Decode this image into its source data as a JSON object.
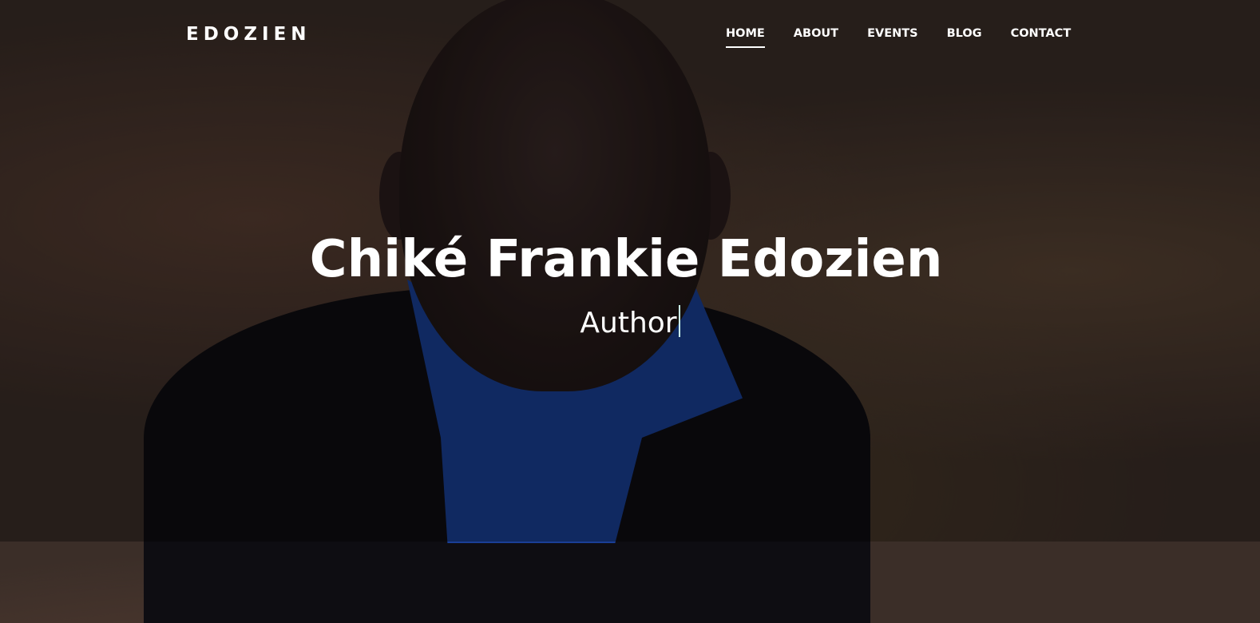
{
  "nav": {
    "logo": "EDOZIEN",
    "items": [
      {
        "label": "HOME",
        "active": true
      },
      {
        "label": "ABOUT"
      },
      {
        "label": "EVENTS"
      },
      {
        "label": "BLOG"
      },
      {
        "label": "CONTACT"
      }
    ]
  },
  "hero": {
    "title": "Chiké Frankie Edozien",
    "subtitle": "Author"
  }
}
